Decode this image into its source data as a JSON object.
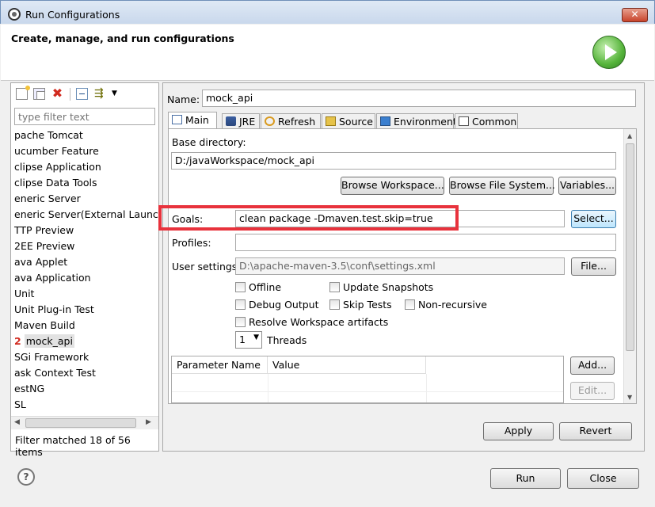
{
  "window": {
    "title": "Run Configurations"
  },
  "header": {
    "heading": "Create, manage, and run configurations"
  },
  "left": {
    "filter_placeholder": "type filter text",
    "items": [
      {
        "label": "pache Tomcat"
      },
      {
        "label": "ucumber Feature"
      },
      {
        "label": "clipse Application"
      },
      {
        "label": "clipse Data Tools"
      },
      {
        "label": "eneric Server"
      },
      {
        "label": "eneric Server(External Launch)"
      },
      {
        "label": "TTP Preview"
      },
      {
        "label": "2EE Preview"
      },
      {
        "label": "ava Applet"
      },
      {
        "label": "ava Application"
      },
      {
        "label": "Unit"
      },
      {
        "label": "Unit Plug-in Test"
      },
      {
        "label": "Maven Build"
      },
      {
        "label": "mock_api",
        "mark": "2",
        "selected": true
      },
      {
        "label": "SGi Framework"
      },
      {
        "label": "ask Context Test"
      },
      {
        "label": "estNG"
      },
      {
        "label": "SL"
      }
    ],
    "status": "Filter matched 18 of 56 items"
  },
  "main": {
    "name_label": "Name:",
    "name_value": "mock_api",
    "tabs": [
      "Main",
      "JRE",
      "Refresh",
      "Source",
      "Environment",
      "Common"
    ],
    "base_dir_label": "Base directory:",
    "base_dir_value": "D:/javaWorkspace/mock_api",
    "browse_workspace": "Browse Workspace...",
    "browse_filesystem": "Browse File System...",
    "variables": "Variables...",
    "goals_label": "Goals:",
    "goals_value": "clean package -Dmaven.test.skip=true",
    "select": "Select...",
    "profiles_label": "Profiles:",
    "profiles_value": "",
    "user_settings_label": "User settings:",
    "user_settings_value": "D:\\apache-maven-3.5\\conf\\settings.xml",
    "file_button": "File...",
    "checkboxes": {
      "offline": "Offline",
      "update_snapshots": "Update Snapshots",
      "debug_output": "Debug Output",
      "skip_tests": "Skip Tests",
      "non_recursive": "Non-recursive",
      "resolve_workspace": "Resolve Workspace artifacts"
    },
    "threads_value": "1",
    "threads_label": "Threads",
    "param_columns": [
      "Parameter Name",
      "Value"
    ],
    "add": "Add...",
    "edit": "Edit...",
    "apply": "Apply",
    "revert": "Revert"
  },
  "footer": {
    "run": "Run",
    "close": "Close"
  },
  "colors": {
    "highlight": "#e8323c",
    "delete_icon": "#d12a1f",
    "run_logo": "#56b43b"
  }
}
